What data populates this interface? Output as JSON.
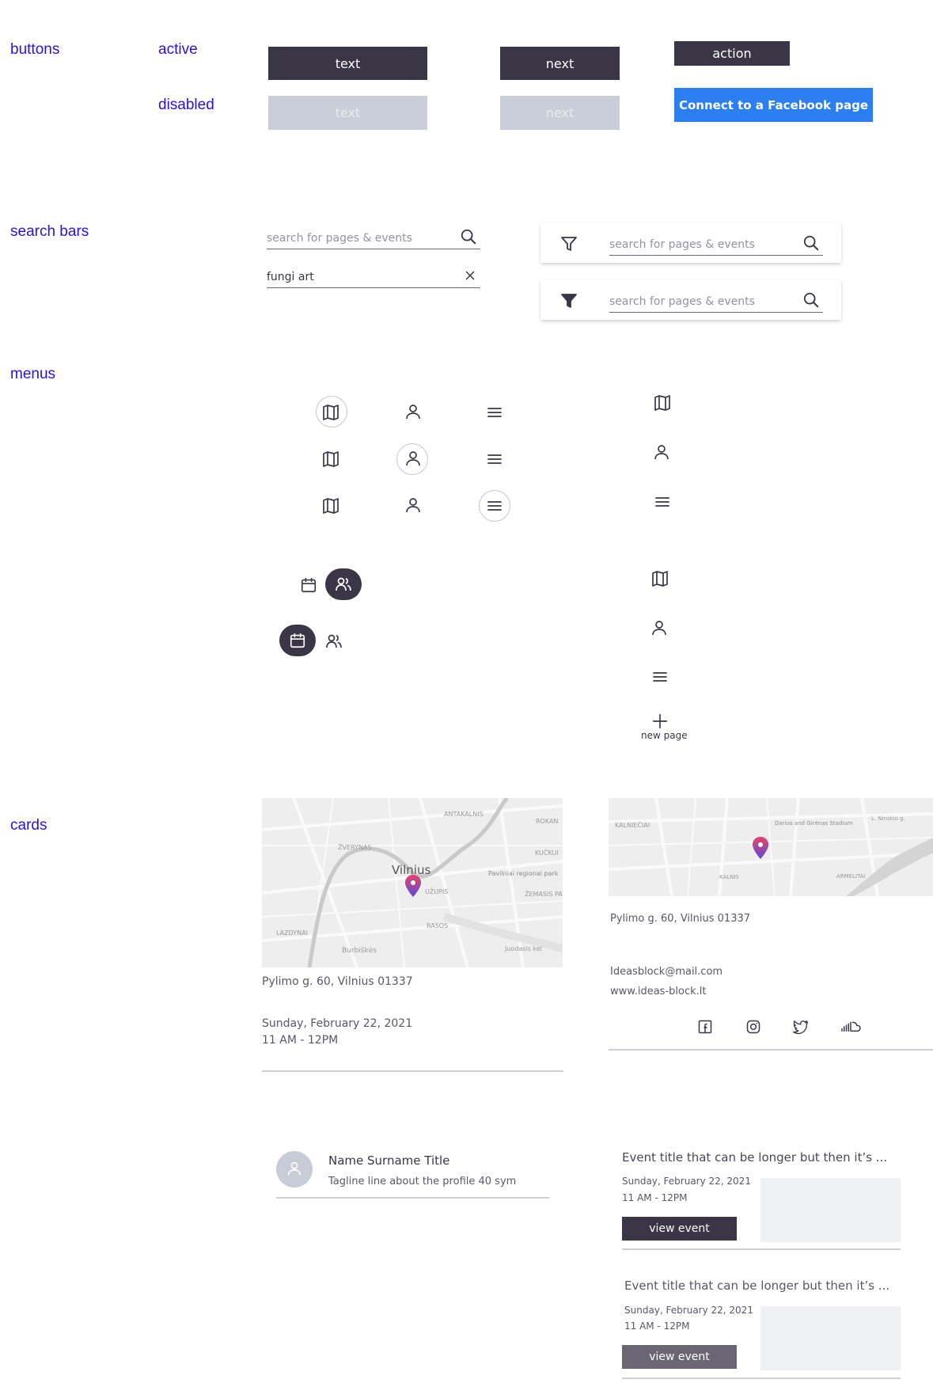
{
  "sections": {
    "buttons": "buttons",
    "search_bars": "search bars",
    "menus": "menus",
    "cards": "cards"
  },
  "states": {
    "active": "active",
    "disabled": "disabled"
  },
  "buttons": {
    "text_active": "text",
    "next_active": "next",
    "action": "action",
    "text_disabled": "text",
    "next_disabled": "next",
    "facebook": "Connect to a Facebook page"
  },
  "search": {
    "placeholder": "search for pages & events",
    "value": "fungi art"
  },
  "menu": {
    "new_page": "new page"
  },
  "map": {
    "city": "Vilnius",
    "labels": [
      "ANTAKALNIS",
      "ŽVERYNAS",
      "ROKAN",
      "KUČKUI",
      "UŽUPIS",
      "Pavilniai regional park",
      "ŽEMASIS PAVILNYS",
      "RASOS",
      "LAZDYNAI",
      "Burbiškės",
      "Juodasis kel"
    ],
    "labels2": [
      "KALNIEČIAI",
      "Darius and Girėnas Stadium",
      "L. Ninskio g.",
      "ARMELITAI",
      "KALNIS"
    ]
  },
  "card_event": {
    "address": "Pylimo g. 60, Vilnius 01337",
    "date": "Sunday,  February 22, 2021",
    "time": "11 AM - 12PM"
  },
  "card_venue": {
    "address": "Pylimo g. 60, Vilnius 01337",
    "email": "Ideasblock@mail.com",
    "website": "www.ideas-block.lt"
  },
  "profile": {
    "name": "Name Surname Title",
    "tagline": "Tagline line about the profile 40 sym"
  },
  "event_items": [
    {
      "title": "Event title that can be longer but then it’s ...",
      "date": "Sunday,  February 22, 2021",
      "time": "11 AM - 12PM",
      "button": "view event"
    },
    {
      "title": "Event title that can be longer but then it’s ...",
      "date": "Sunday,  February 22, 2021",
      "time": "11 AM - 12PM",
      "button": "view event"
    }
  ],
  "colors": {
    "accent_label": "#2a10e8",
    "dark": "#3b3646",
    "disabled": "#c9ced8",
    "facebook_blue": "#2b7ff0",
    "pin_top": "#e8436b",
    "pin_bottom": "#5b4ad8"
  }
}
